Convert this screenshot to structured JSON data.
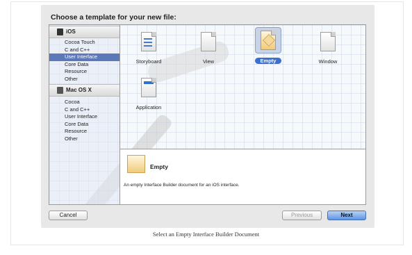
{
  "dialog": {
    "title": "Choose a template for your new file:"
  },
  "sidebar": {
    "sections": [
      {
        "name": "iOS",
        "icon": "ios-device-icon",
        "items": [
          "Cocoa Touch",
          "C and C++",
          "User Interface",
          "Core Data",
          "Resource",
          "Other"
        ],
        "selected": "User Interface"
      },
      {
        "name": "Mac OS X",
        "icon": "mac-icon",
        "items": [
          "Cocoa",
          "C and C++",
          "User Interface",
          "Core Data",
          "Resource",
          "Other"
        ]
      }
    ]
  },
  "templates": [
    {
      "label": "Storyboard",
      "icon": "storyboard-doc-icon"
    },
    {
      "label": "View",
      "icon": "blank-doc-icon"
    },
    {
      "label": "Empty",
      "icon": "empty-doc-icon",
      "selected": true
    },
    {
      "label": "Window",
      "icon": "blank-doc-icon"
    },
    {
      "label": "Application",
      "icon": "application-doc-icon"
    }
  ],
  "detail": {
    "name": "Empty",
    "description": "An empty Interface Builder document for an iOS interface.",
    "icon": "empty-doc-icon"
  },
  "buttons": {
    "cancel": "Cancel",
    "previous": "Previous",
    "next": "Next"
  },
  "caption": "Select an Empty Interface Builder Document",
  "colors": {
    "selection_blue": "#5b79b8",
    "default_button": "#5d95e6"
  }
}
